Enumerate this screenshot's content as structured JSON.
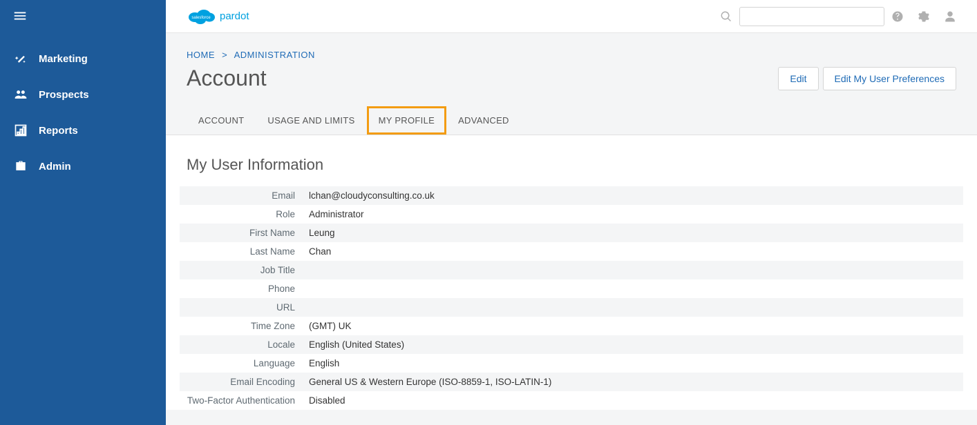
{
  "brand": {
    "product": "pardot",
    "cloud_text": "salesforce"
  },
  "sidebar": {
    "items": [
      {
        "label": "Marketing"
      },
      {
        "label": "Prospects"
      },
      {
        "label": "Reports"
      },
      {
        "label": "Admin"
      }
    ]
  },
  "breadcrumb": {
    "home": "HOME",
    "administration": "ADMINISTRATION",
    "sep": ">"
  },
  "page": {
    "title": "Account",
    "edit_label": "Edit",
    "prefs_label": "Edit My User Preferences"
  },
  "tabs": [
    {
      "label": "ACCOUNT"
    },
    {
      "label": "USAGE AND LIMITS"
    },
    {
      "label": "MY PROFILE"
    },
    {
      "label": "ADVANCED"
    }
  ],
  "section": {
    "title": "My User Information"
  },
  "fields": [
    {
      "label": "Email",
      "value": "lchan@cloudyconsulting.co.uk"
    },
    {
      "label": "Role",
      "value": "Administrator"
    },
    {
      "label": "First Name",
      "value": "Leung"
    },
    {
      "label": "Last Name",
      "value": "Chan"
    },
    {
      "label": "Job Title",
      "value": ""
    },
    {
      "label": "Phone",
      "value": ""
    },
    {
      "label": "URL",
      "value": ""
    },
    {
      "label": "Time Zone",
      "value": "(GMT) UK"
    },
    {
      "label": "Locale",
      "value": "English (United States)"
    },
    {
      "label": "Language",
      "value": "English"
    },
    {
      "label": "Email Encoding",
      "value": "General US & Western Europe (ISO-8859-1, ISO-LATIN-1)"
    },
    {
      "label": "Two-Factor Authentication",
      "value": "Disabled"
    }
  ]
}
